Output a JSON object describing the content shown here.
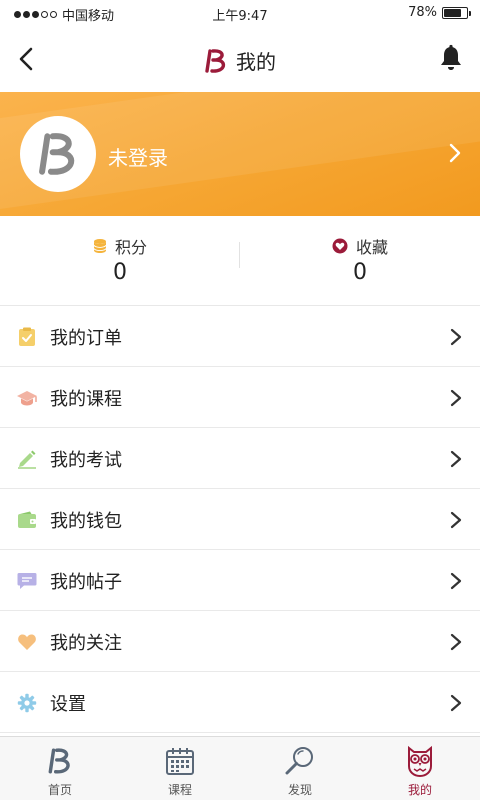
{
  "status_bar": {
    "carrier": "中国移动",
    "time": "上午9:47",
    "battery": "78%",
    "battery_level": 0.78
  },
  "nav": {
    "title": "我的"
  },
  "profile": {
    "name": "未登录"
  },
  "stats": [
    {
      "label": "积分",
      "value": "0",
      "icon": "coins-icon"
    },
    {
      "label": "收藏",
      "value": "0",
      "icon": "heart-icon"
    }
  ],
  "menu": [
    {
      "label": "我的订单",
      "icon": "order-icon",
      "color": "#f5cf6a"
    },
    {
      "label": "我的课程",
      "icon": "graduation-cap-icon",
      "color": "#f2b3a3"
    },
    {
      "label": "我的考试",
      "icon": "pencil-icon",
      "color": "#a9d98b"
    },
    {
      "label": "我的钱包",
      "icon": "wallet-icon",
      "color": "#a9d98b"
    },
    {
      "label": "我的帖子",
      "icon": "message-icon",
      "color": "#b7b1e6"
    },
    {
      "label": "我的关注",
      "icon": "heart-icon",
      "color": "#f6bf7d"
    },
    {
      "label": "设置",
      "icon": "gear-icon",
      "color": "#8fcbe8"
    }
  ],
  "tabs": [
    {
      "label": "首页",
      "icon": "home-logo-icon",
      "active": false
    },
    {
      "label": "课程",
      "icon": "calendar-icon",
      "active": false
    },
    {
      "label": "发现",
      "icon": "magnifier-icon",
      "active": false
    },
    {
      "label": "我的",
      "icon": "owl-icon",
      "active": true
    }
  ],
  "colors": {
    "brand": "#9b1b3a",
    "banner": "#f6a734",
    "banner_light": "#fbb34d"
  }
}
